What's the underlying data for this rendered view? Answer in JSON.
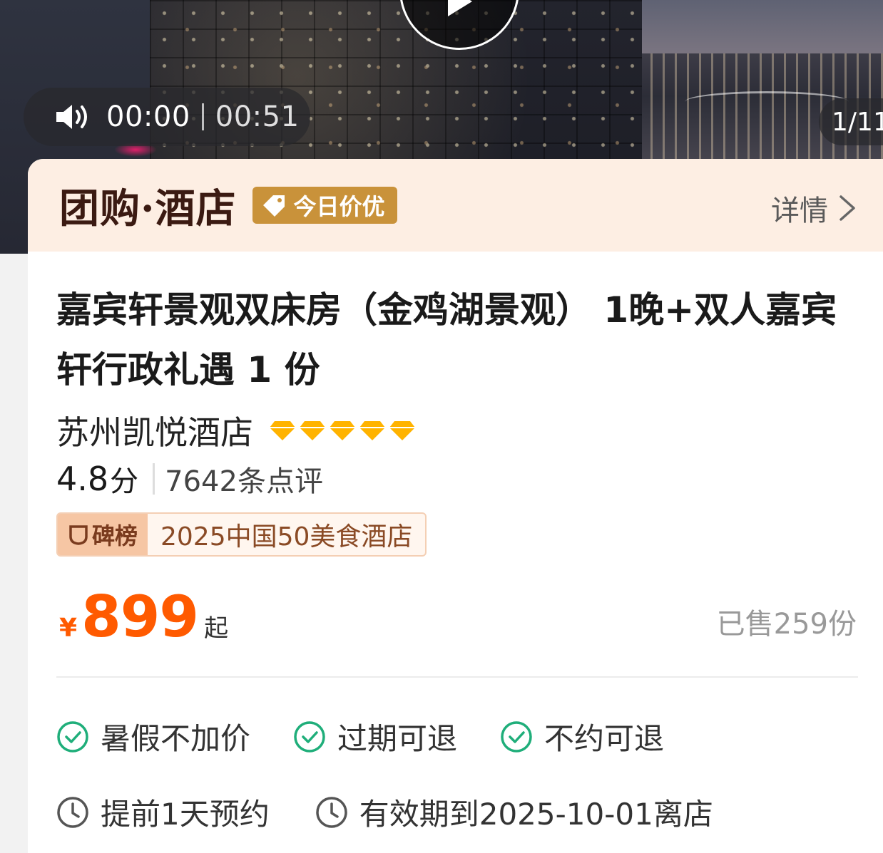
{
  "hero": {
    "current_time": "00:00",
    "duration": "00:51",
    "image_counter": "1/11"
  },
  "header": {
    "brand": "团购·酒店",
    "badge": "今日价优",
    "detail_link": "详情"
  },
  "product": {
    "title": "嘉宾轩景观双床房（金鸡湖景观） 1晚+双人嘉宾轩行政礼遇 1 份",
    "hotel_name": "苏州凯悦酒店",
    "diamond_count": 5,
    "score": "4.8",
    "score_unit": "分",
    "reviews": "7642条点评",
    "rank_label": "碑榜",
    "rank_title": "2025中国50美食酒店",
    "currency": "¥",
    "price": "899",
    "price_suffix": "起",
    "sold": "已售259份"
  },
  "policies": [
    {
      "label": "暑假不加价",
      "icon": "check-circle-icon"
    },
    {
      "label": "过期可退",
      "icon": "check-circle-icon"
    },
    {
      "label": "不约可退",
      "icon": "check-circle-icon"
    }
  ],
  "info": [
    {
      "label": "提前1天预约",
      "icon": "clock-icon"
    },
    {
      "label": "有效期到2025-10-01离店",
      "icon": "clock-icon"
    }
  ],
  "colors": {
    "price": "#ff5a00",
    "badge": "#c9923a",
    "header_bg": "#fdeee3",
    "check": "#1fae7a",
    "diamond": "#ffb300"
  }
}
